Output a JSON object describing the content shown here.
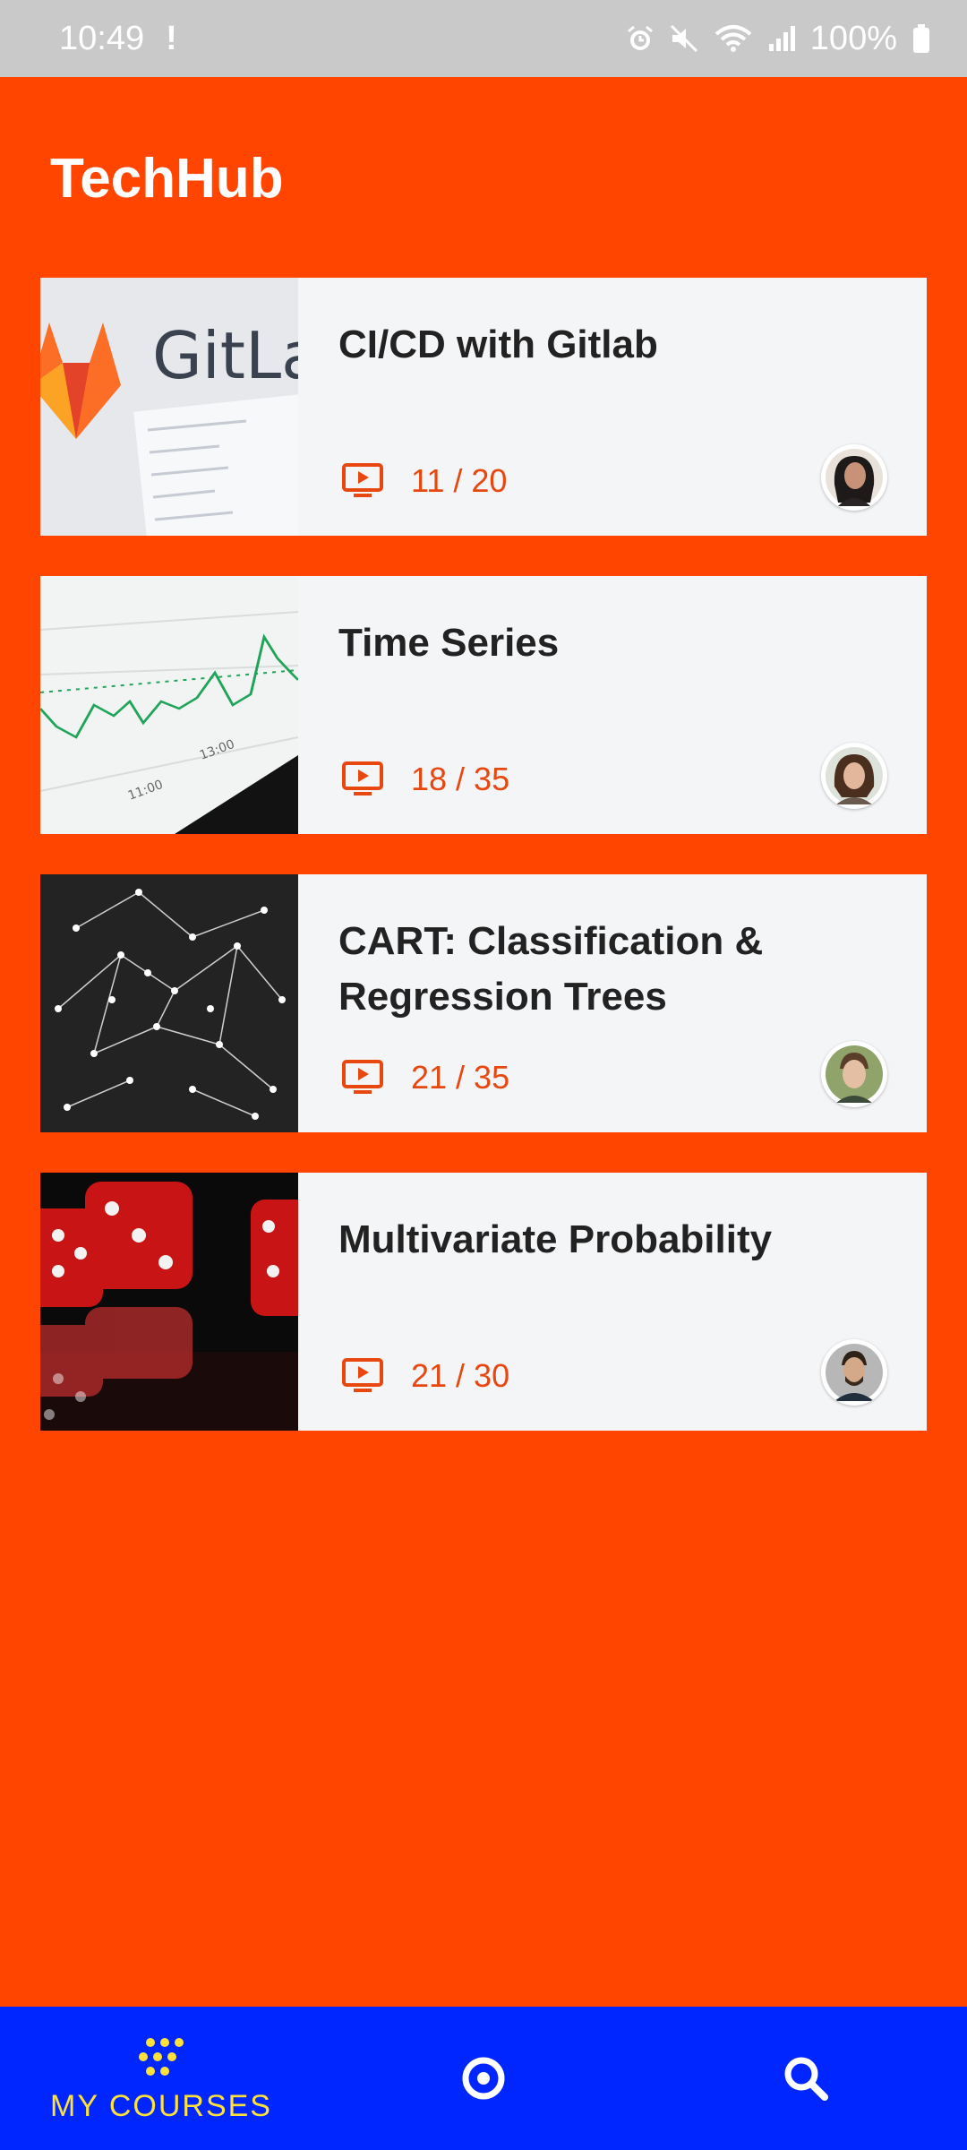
{
  "status_bar": {
    "time": "10:49",
    "alert_glyph": "!",
    "battery_text": "100%",
    "icons": [
      "alarm-icon",
      "mute-icon",
      "wifi-icon",
      "signal-icon",
      "battery-icon"
    ]
  },
  "app": {
    "title": "TechHub"
  },
  "courses": [
    {
      "title": "CI/CD with Gitlab",
      "progress": "11 / 20",
      "thumbnail": "gitlab-logo",
      "instructor_avatar": "female-instructor"
    },
    {
      "title": "Time Series",
      "progress": "18 / 35",
      "thumbnail": "line-chart",
      "instructor_avatar": "female-instructor"
    },
    {
      "title": "CART: Classification & Regression Trees",
      "progress": "21 / 35",
      "thumbnail": "pin-network",
      "instructor_avatar": "male-instructor"
    },
    {
      "title": "Multivariate Probability",
      "progress": "21 / 30",
      "thumbnail": "red-dice",
      "instructor_avatar": "male-instructor-bearded"
    }
  ],
  "bottom_nav": {
    "items": [
      {
        "label": "MY COURSES",
        "icon": "dots-grid-icon",
        "active": true
      },
      {
        "label": "",
        "icon": "target-icon",
        "active": false
      },
      {
        "label": "",
        "icon": "search-icon",
        "active": false
      }
    ]
  },
  "colors": {
    "background": "#FF4500",
    "card": "#F4F5F7",
    "accent": "#E8470F",
    "nav": "#0026FF",
    "nav_active": "#FFE13A",
    "status_bar": "#C9C9C9"
  }
}
